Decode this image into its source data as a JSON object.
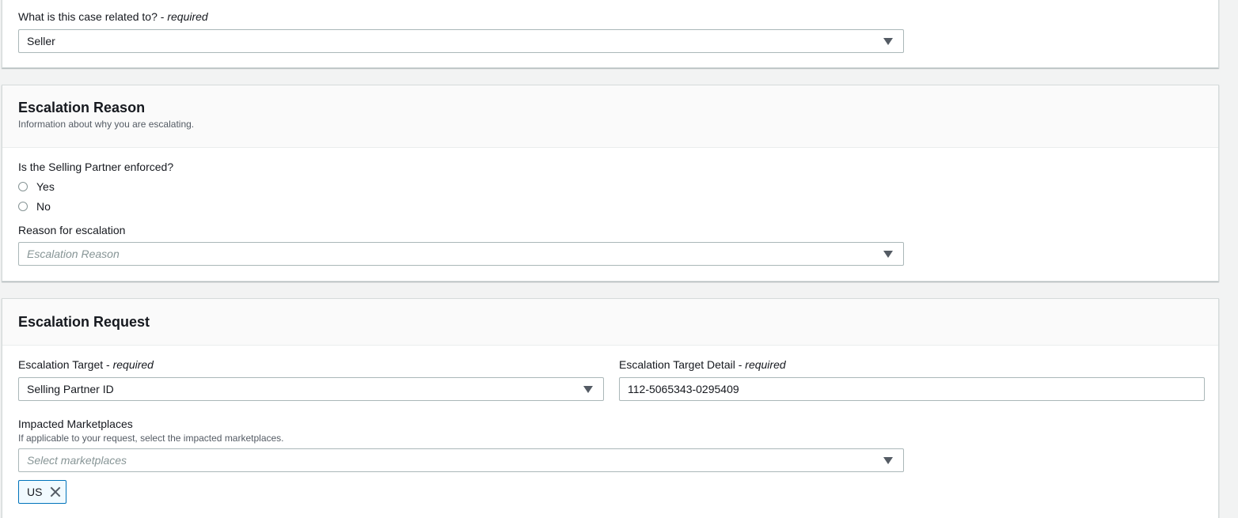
{
  "case_section": {
    "related_label": "What is this case related to?",
    "required_suffix": " - ",
    "required_word": "required",
    "related_value": "Seller"
  },
  "escalation_reason": {
    "title": "Escalation Reason",
    "description": "Information about why you are escalating.",
    "enforced_question": "Is the Selling Partner enforced?",
    "options": [
      "Yes",
      "No"
    ],
    "reason_label": "Reason for escalation",
    "reason_placeholder": "Escalation Reason"
  },
  "escalation_request": {
    "title": "Escalation Request",
    "target_label": "Escalation Target",
    "target_required": "required",
    "target_value": "Selling Partner ID",
    "detail_label": "Escalation Target Detail",
    "detail_required": "required",
    "detail_value": "112-5065343-0295409",
    "marketplaces_label": "Impacted Marketplaces",
    "marketplaces_help": "If applicable to your request, select the impacted marketplaces.",
    "marketplaces_placeholder": "Select marketplaces",
    "selected_tokens": [
      "US"
    ]
  },
  "colors": {
    "accent": "#0073bb",
    "background": "#f2f3f3",
    "header_bg": "#fafafa"
  }
}
